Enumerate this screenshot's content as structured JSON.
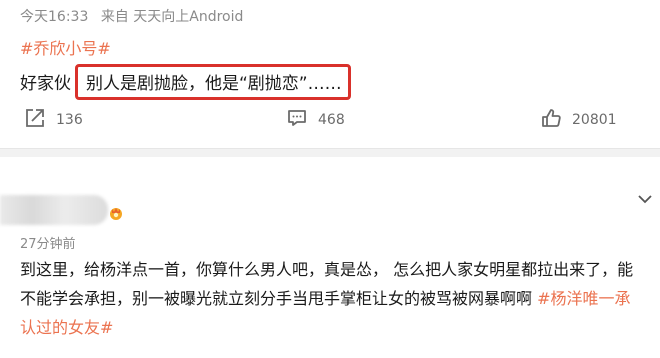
{
  "post": {
    "time": "今天16:33",
    "source": "来自 天天向上Android",
    "topic": "#乔欣小号#",
    "lead": "好家伙",
    "highlight": "别人是剧抛脸，他是“剧抛恋”……",
    "forward_count": "136",
    "comment_count": "468",
    "like_count": "20801"
  },
  "comment": {
    "time": "27分钟前",
    "line1": "到这里，给杨洋点一首，你算什么男人吧，真是怂， 怎么把人家女明星都拉出来了，能",
    "line2": "不能学会承担，别一被曝光就立刻分手当甩手掌柜让女的被骂被网暴啊啊 ",
    "line2_tag": "#杨洋唯一承",
    "line3_tag": "认过的女友#"
  },
  "colors": {
    "accent": "#eb7350",
    "highlight_border": "#d9312b"
  },
  "icons": [
    "forward-icon",
    "comment-icon",
    "like-icon",
    "chevron-down-icon",
    "badge-icon"
  ]
}
